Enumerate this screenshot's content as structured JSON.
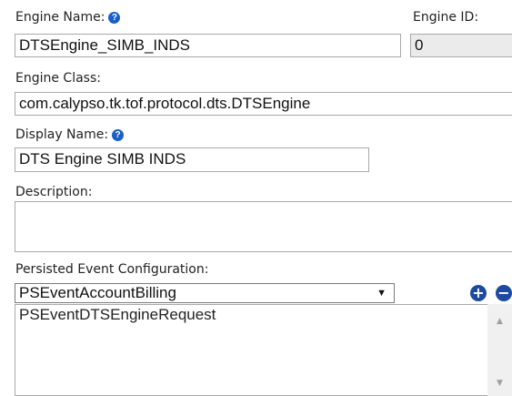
{
  "engine_name": {
    "label": "Engine Name:",
    "value": "DTSEngine_SIMB_INDS",
    "help_icon": "question-circle-icon"
  },
  "engine_id": {
    "label": "Engine ID:",
    "value": "0"
  },
  "engine_class": {
    "label": "Engine Class:",
    "value": "com.calypso.tk.tof.protocol.dts.DTSEngine"
  },
  "display_name": {
    "label": "Display Name:",
    "value": "DTS Engine SIMB INDS",
    "help_icon": "question-circle-icon"
  },
  "description": {
    "label": "Description:",
    "value": ""
  },
  "persisted_event": {
    "label": "Persisted Event Configuration:",
    "selected": "PSEventAccountBilling",
    "add_icon": "plus-circle-icon",
    "remove_icon": "minus-circle-icon",
    "items": [
      "PSEventDTSEngineRequest"
    ]
  },
  "colors": {
    "help_blue": "#1a5fc8",
    "action_blue": "#1c4aa0"
  }
}
